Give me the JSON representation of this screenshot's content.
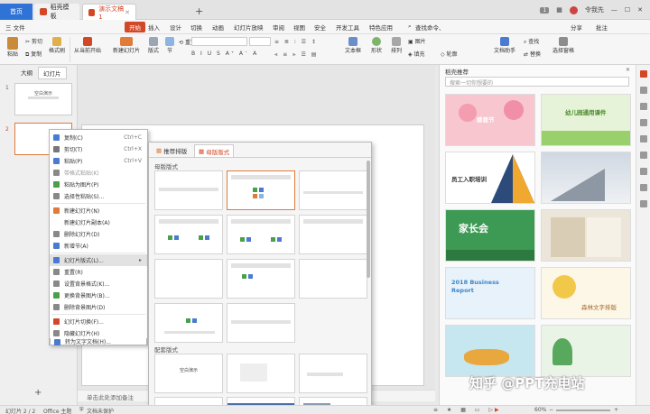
{
  "titlebar": {
    "home_tab": "首页",
    "tab1": "稻壳模板",
    "tab2": "演示文稿1",
    "badge": "1",
    "user": "令我先"
  },
  "menubar": {
    "file": "三 文件",
    "start": "开始",
    "items": [
      "插入",
      "设计",
      "切换",
      "动画",
      "幻灯片放映",
      "审阅",
      "视图",
      "安全",
      "开发工具",
      "特色应用"
    ],
    "search": "查找命令、",
    "share": "分享",
    "comment": "批注"
  },
  "ribbon": {
    "paste": "粘贴",
    "cut": "剪切",
    "copy": "复制",
    "format_painter": "格式刷",
    "from_current": "从当前开始",
    "new_slide": "新建幻灯片",
    "layout": "版式",
    "section": "节",
    "reset": "重置",
    "textbox": "文本框",
    "shape": "形状",
    "arrange": "排列",
    "picture": "图片",
    "fill": "填充",
    "outline": "轮廓",
    "doc_assistant": "文档助手",
    "find": "查找",
    "replace": "替换",
    "select_pane": "选择窗格"
  },
  "leftpanel": {
    "tab_outline": "大纲",
    "tab_slides": "幻灯片",
    "slide1_num": "1",
    "slide1_text": "空白演示",
    "slide2_num": "2",
    "add_icon": "+"
  },
  "context_menu": {
    "items": [
      {
        "label": "复制(C)",
        "shortcut": "Ctrl+C",
        "icon_color": "#4a7bd0"
      },
      {
        "label": "剪切(T)",
        "shortcut": "Ctrl+X",
        "icon_color": "#777777"
      },
      {
        "label": "粘贴(P)",
        "shortcut": "Ctrl+V",
        "icon_color": "#4a7bd0"
      },
      {
        "label": "带格式粘贴(K)",
        "shortcut": "",
        "icon_color": "#888888"
      },
      {
        "label": "粘贴为图片(P)",
        "shortcut": "",
        "icon_color": "#4aa04a"
      },
      {
        "label": "选择性粘贴(S)...",
        "shortcut": "",
        "icon_color": "#888888"
      },
      {
        "label": "新建幻灯片(N)",
        "shortcut": "",
        "icon_color": "#e07b39"
      },
      {
        "label": "新建幻灯片副本(A)",
        "shortcut": "",
        "icon_color": ""
      },
      {
        "label": "删除幻灯片(D)",
        "shortcut": "",
        "icon_color": "#888888"
      },
      {
        "label": "新增节(A)",
        "shortcut": "",
        "icon_color": "#4a7bd0"
      },
      {
        "label": "幻灯片版式(L)...",
        "shortcut": "",
        "icon_color": "#4a7bd0"
      },
      {
        "label": "重置(R)",
        "shortcut": "",
        "icon_color": "#888888"
      },
      {
        "label": "设置背景格式(K)...",
        "shortcut": "",
        "icon_color": "#888888"
      },
      {
        "label": "更换背景图片(B)...",
        "shortcut": "",
        "icon_color": "#4aa04a"
      },
      {
        "label": "删除背景图片(D)",
        "shortcut": "",
        "icon_color": "#888888"
      },
      {
        "label": "幻灯片切换(F)...",
        "shortcut": "",
        "icon_color": "#d24726"
      },
      {
        "label": "隐藏幻灯片(H)",
        "shortcut": "",
        "icon_color": "#888888"
      },
      {
        "label": "转为文字文档(H)...",
        "shortcut": "",
        "icon_color": "#4a7bd0"
      }
    ]
  },
  "layout_popup": {
    "tab_recommended": "推荐排版",
    "tab_master": "母版版式",
    "section_master": "母版版式",
    "section_matched": "配套版式",
    "thumb_title": "空白演示"
  },
  "right_pane": {
    "title": "稻壳推荐",
    "search_placeholder": "搜索一切你想要的",
    "templates": [
      {
        "title": "感恩节",
        "bg": "#f7c6cf"
      },
      {
        "title": "幼儿园通用课件",
        "bg": "#e6f3d8"
      },
      {
        "title": "员工入职培训",
        "bg": "#ffffff"
      },
      {
        "title": "",
        "bg": "#d7dde5"
      },
      {
        "title": "家长会",
        "bg": "#3d9a54"
      },
      {
        "title": "",
        "bg": "#ece6da"
      },
      {
        "title": "2018 Business Report",
        "bg": "#e8f2fb"
      },
      {
        "title": "森林文字排版",
        "bg": "#fdf7e8"
      },
      {
        "title": "",
        "bg": "#c6e6f0"
      },
      {
        "title": "",
        "bg": "#e9f3e6"
      }
    ]
  },
  "notes": {
    "placeholder": "单击此处添加备注"
  },
  "status": {
    "slide_count": "幻灯片 2 / 2",
    "theme": "Office 主题",
    "protect": "文档未保护",
    "zoom": "60%"
  },
  "watermark": "知乎 @PPT充电站",
  "colors": {
    "accent": "#d24726",
    "home_tab": "#2f73d6",
    "selection": "#e07b39"
  }
}
